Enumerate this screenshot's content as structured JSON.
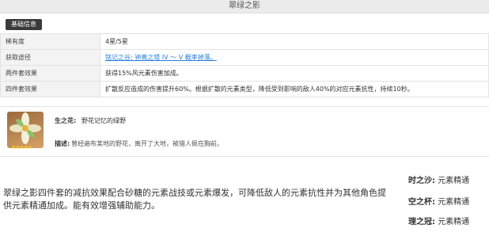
{
  "page_title": "翠绿之影",
  "tag_label": "基础信息",
  "info_rows": [
    {
      "key": "稀有度",
      "value": "4星/5星"
    },
    {
      "key": "获取途径",
      "value": "铭记之谷; 钟离之塔 IV ～ V 概率掉落。"
    },
    {
      "key": "两件套效果",
      "value": "获得15%风元素伤害加成。"
    },
    {
      "key": "四件套效果",
      "value": "扩散反应造成的伤害提升60%。根据扩散的元素类型，降低受到影响的敌人40%的对应元素抗性，持续10秒。"
    }
  ],
  "flower": {
    "name_label": "生之花:",
    "name": "野花记忆的绿野",
    "desc_label": "描述:",
    "desc": "曾经遍布某地的野花，离开了大地，被猎人佩在胸前。",
    "stars": "★★★★★"
  },
  "summary": "翠绿之影四件套的减抗效果配合砂糖的元素战技或元素爆发，可降低敌人的元素抗性并为其他角色提供元素精通加成。能有效增强辅助能力。",
  "stats": [
    {
      "label": "时之沙:",
      "value": "元素精通"
    },
    {
      "label": "空之杯:",
      "value": "元素精通"
    },
    {
      "label": "理之冠:",
      "value": "元素精通"
    }
  ]
}
